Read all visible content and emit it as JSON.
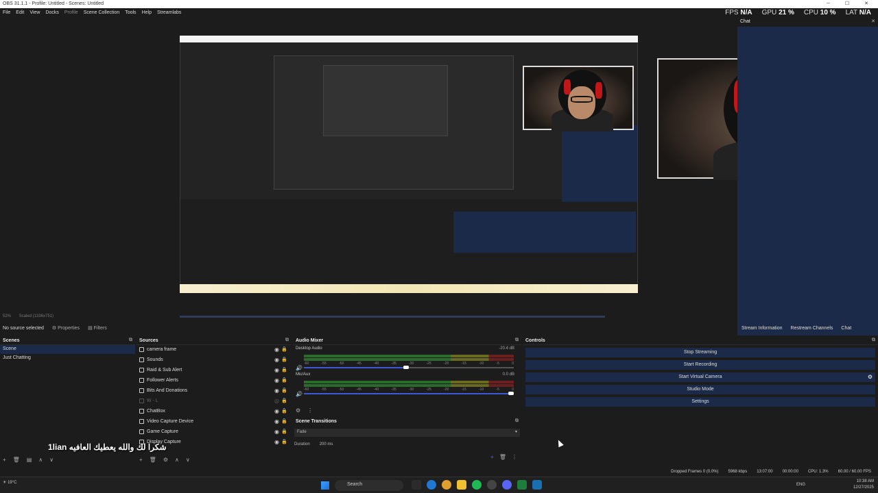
{
  "window": {
    "title": "OBS 31.1.1 - Profile: Untitled - Scenes: Untitled",
    "controls": "─ ☐ ✕"
  },
  "menu": [
    "File",
    "Edit",
    "View",
    "Docks",
    "Profile",
    "Scene Collection",
    "Tools",
    "Help",
    "Streamlabs"
  ],
  "stats": {
    "fps_label": "FPS",
    "fps": "N/A",
    "gpu_label": "GPU",
    "gpu": "21 %",
    "cpu_label": "CPU",
    "cpu": "10 %",
    "lat_label": "LAT",
    "lat": "N/A"
  },
  "chat_dock": {
    "title": "Chat",
    "close": "✕"
  },
  "zoom": {
    "level": "52%",
    "scaled": "Scaled (1336x751)"
  },
  "source_bar": {
    "none": "No source selected",
    "properties": "Properties",
    "filters": "Filters"
  },
  "dock_tabs": [
    "Stream Information",
    "Restream Channels",
    "Chat"
  ],
  "scenes": {
    "title": "Scenes",
    "items": [
      "Scene",
      "Just Chatting"
    ]
  },
  "sources": {
    "title": "Sources",
    "items": [
      "camera frame",
      "Sounds",
      "Raid & Sub Alert",
      "Follower Alerts",
      "Bits And Donations",
      "W - L",
      "ChatBox",
      "Video Capture Device",
      "Game Capture",
      "Display Capture"
    ]
  },
  "mixer": {
    "title": "Audio Mixer",
    "channels": [
      {
        "name": "Desktop Audio",
        "db": "-20.4 dB",
        "volume": 0.5
      },
      {
        "name": "Mic/Aux",
        "db": "0.0 dB",
        "volume": 1.0
      }
    ],
    "ticks": [
      "-60",
      "-55",
      "-50",
      "-45",
      "-40",
      "-35",
      "-30",
      "-25",
      "-20",
      "-15",
      "-10",
      "-5",
      "0"
    ]
  },
  "transitions": {
    "title": "Scene Transitions",
    "selected": "Fade",
    "duration_label": "Duration",
    "duration": "200 ms"
  },
  "controls": {
    "title": "Controls",
    "buttons": [
      "Stop Streaming",
      "Start Recording",
      "Start Virtual Camera",
      "Studio Mode",
      "Settings"
    ]
  },
  "status": {
    "dropped": "Dropped Frames 0 (0.0%)",
    "kbps": "5968 kbps",
    "live": "13:07:00",
    "rec": "00:00:00",
    "cpu": "CPU: 1.3%",
    "fps": "60.00 / 60.00 FPS"
  },
  "overlay_text": "1lian شكرا لك والله يعطيك العافيه",
  "taskbar": {
    "search": "Search",
    "weather": "19°C",
    "lang": "ENG",
    "time": "10:38 AM",
    "date": "12/27/2025"
  },
  "colors": {
    "accent": "#1c2a4a",
    "bg": "#1c1c1c"
  }
}
